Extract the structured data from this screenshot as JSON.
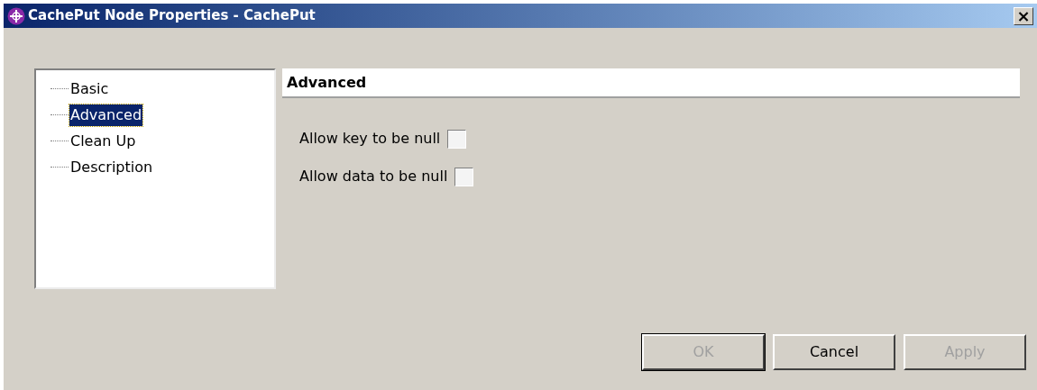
{
  "window": {
    "title": "CachePut Node Properties - CachePut",
    "close": "×"
  },
  "tree": [
    {
      "label": "Basic",
      "selected": false
    },
    {
      "label": "Advanced",
      "selected": true
    },
    {
      "label": "Clean Up",
      "selected": false
    },
    {
      "label": "Description",
      "selected": false
    }
  ],
  "section_title": "Advanced",
  "options": [
    {
      "label": "Allow key to be null",
      "checked": false
    },
    {
      "label": "Allow data to be null",
      "checked": false
    }
  ],
  "buttons": [
    {
      "label": "OK",
      "disabled": true
    },
    {
      "label": "Cancel",
      "disabled": false
    },
    {
      "label": "Apply",
      "disabled": true
    }
  ]
}
